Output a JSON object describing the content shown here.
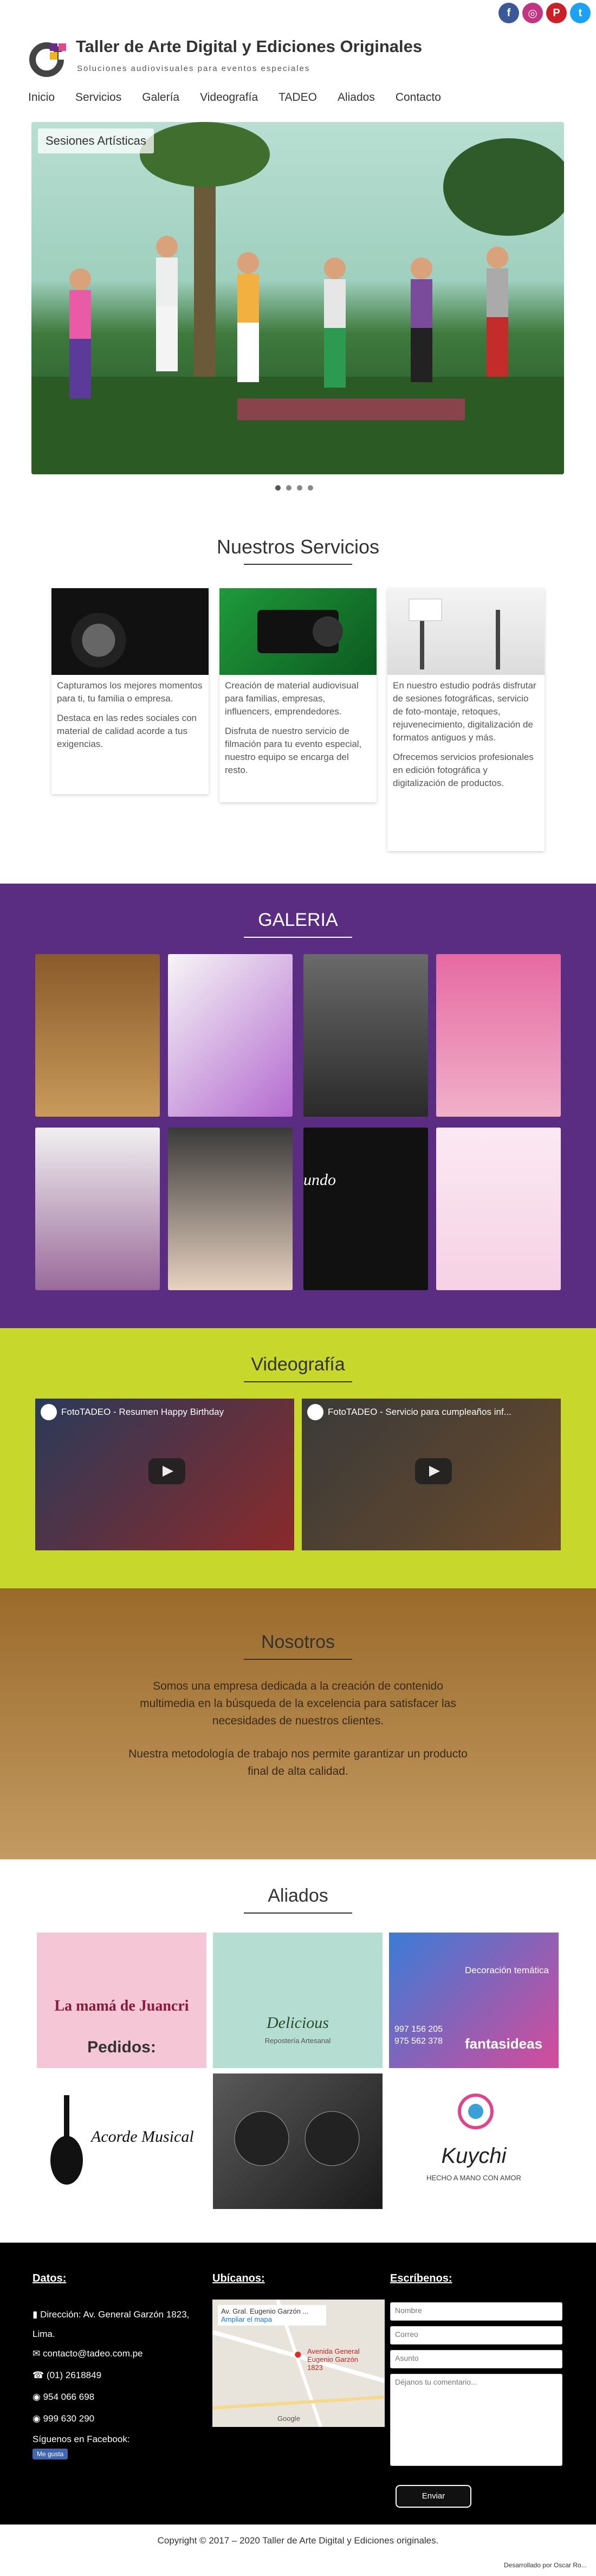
{
  "header": {
    "title": "Taller de Arte Digital y Ediciones Originales",
    "tagline": "Soluciones audiovisuales para eventos especiales",
    "social": [
      {
        "icon": "facebook-icon",
        "color": "#3b5998",
        "glyph": "f"
      },
      {
        "icon": "instagram-icon",
        "color": "#c13584",
        "glyph": "◎"
      },
      {
        "icon": "pinterest-icon",
        "color": "#cb2027",
        "glyph": "P"
      },
      {
        "icon": "twitter-icon",
        "color": "#1da1f2",
        "glyph": "t"
      }
    ]
  },
  "nav": [
    "Inicio",
    "Servicios",
    "Galería",
    "Videografía",
    "TADEO",
    "Aliados",
    "Contacto"
  ],
  "slider": {
    "caption": "Sesiones Artísticas",
    "dots": 4
  },
  "services": {
    "title": "Nuestros Servicios",
    "cards": [
      {
        "p1": "Capturamos los mejores momentos para ti, tu familia o empresa.",
        "p2": "Destaca en las redes sociales con material de calidad acorde a tus exigencias."
      },
      {
        "p1": "Creación de material audiovisual para familias, empresas, influencers, emprendedores.",
        "p2": "Disfruta de nuestro servicio de filmación para tu evento especial, nuestro equipo se encarga del resto."
      },
      {
        "p1": "En nuestro estudio podrás disfrutar de sesiones fotográficas, servicio de foto-montaje, retoques, rejuvenecimiento, digitalización de formatos antiguos y más.",
        "p2": "Ofrecemos servicios profesionales en edición fotográfica y digitalización de productos."
      }
    ]
  },
  "gallery": {
    "title": "GALERIA",
    "overlay_text": "undo"
  },
  "video": {
    "title": "Videografía",
    "videos": [
      {
        "title": "FotoTADEO - Resumen Happy Birthday"
      },
      {
        "title": "FotoTADEO - Servicio para cumpleaños inf..."
      }
    ]
  },
  "about": {
    "title": "Nosotros",
    "p1": "Somos una empresa dedicada a la creación de contenido multimedia en la búsqueda de la excelencia para satisfacer las necesidades de nuestros clientes.",
    "p2": "Nuestra metodología de trabajo nos permite garantizar un producto final de alta calidad."
  },
  "allies": {
    "title": "Aliados",
    "logos": [
      {
        "name": "La mamá de Juancri",
        "sub": "Pedidos:"
      },
      {
        "name": "Delicious",
        "sub": "Repostería Artesanal"
      },
      {
        "name": "fantasideas",
        "sub": "Decoración temática",
        "phones": [
          "997 156 205",
          "975 562 378"
        ]
      },
      {
        "name": "Acorde Musical"
      },
      {
        "name": ""
      },
      {
        "name": "Kuychi",
        "sub": "HECHO A MANO CON AMOR"
      }
    ]
  },
  "footer": {
    "datos_title": "Datos:",
    "address": "Dirección: Av. General Garzón 1823, Lima.",
    "email": "contacto@tadeo.com.pe",
    "phone1": "(01) 2618849",
    "phone2": "954 066 698",
    "phone3": "999 630 290",
    "facebook_follow": "Síguenos en Facebook:",
    "fb_like": "Me gusta",
    "ubicanos_title": "Ubícanos:",
    "map_address": "Av. Gral. Eugenio Garzón ...",
    "map_link": "Ampliar el mapa",
    "map_pin": "Avenida General Eugenio Garzón 1823",
    "map_brand": "Google",
    "escribenos_title": "Escríbenos:",
    "form": {
      "name": "Nombre",
      "email": "Correo",
      "subject": "Asunto",
      "message": "Déjanos tu comentario...",
      "send": "Enviar"
    }
  },
  "bottom": {
    "copyright": "Copyright © 2017 – 2020 Taller de Arte Digital y Ediciones originales.",
    "credit": "Desarrollado por Oscar Ro..."
  },
  "colors": {
    "purple": "#5b2d82",
    "lime": "#c8d72b",
    "brown": "#9a6a2a",
    "footer": "#000000"
  }
}
